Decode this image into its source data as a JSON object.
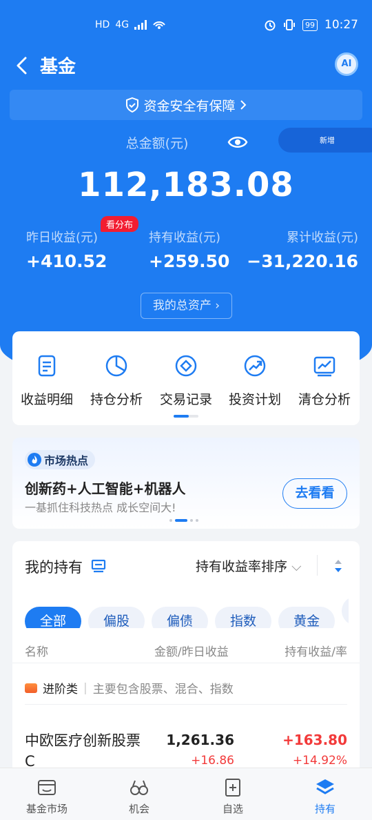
{
  "status": {
    "left_icons": [
      "HD",
      "4G",
      "signal-icon",
      "hotspot-icon"
    ],
    "battery": "99",
    "time": "10:27"
  },
  "nav": {
    "title": "基金",
    "ai_label": "AI"
  },
  "safety": {
    "label": "资金安全有保障"
  },
  "summary": {
    "total_label": "总金额(元)",
    "total_value": "112,183.08",
    "mini_card_text": "新增",
    "dist_badge": "看分布",
    "stats": [
      {
        "label": "昨日收益(元)",
        "value": "+410.52"
      },
      {
        "label": "持有收益(元)",
        "value": "+259.50"
      },
      {
        "label": "累计收益(元)",
        "value": "−31,220.16"
      }
    ],
    "assets_button": "我的总资产"
  },
  "tools": [
    {
      "label": "收益明细",
      "icon": "document-icon"
    },
    {
      "label": "持仓分析",
      "icon": "pie-chart-icon"
    },
    {
      "label": "交易记录",
      "icon": "coin-icon"
    },
    {
      "label": "投资计划",
      "icon": "growth-icon"
    },
    {
      "label": "清仓分析",
      "icon": "chart-box-icon"
    }
  ],
  "hot": {
    "tag": "市场热点",
    "title": "创新药+人工智能+机器人",
    "subtitle": "一基抓住科技热点 成长空间大!",
    "button": "去看看"
  },
  "holdings": {
    "title": "我的持有",
    "sort": "持有收益率排序",
    "chips": [
      "全部",
      "偏股",
      "偏债",
      "指数",
      "黄金",
      ""
    ],
    "col_name": "名称",
    "col_amount": "金额/昨日收益",
    "col_hold": "持有收益/率",
    "category": {
      "name": "进阶类",
      "sep": "|",
      "desc": "主要包含股票、混合、指数"
    },
    "funds": [
      {
        "name": "中欧医疗创新股票C",
        "amount": "1,261.36",
        "yesterday": "+16.86",
        "hold": "+163.80",
        "rate": "+14.92%"
      }
    ]
  },
  "tabbar": [
    {
      "label": "基金市场",
      "icon": "market-icon"
    },
    {
      "label": "机会",
      "icon": "binoculars-icon"
    },
    {
      "label": "自选",
      "icon": "add-favorite-icon"
    },
    {
      "label": "持有",
      "icon": "layers-icon"
    }
  ]
}
